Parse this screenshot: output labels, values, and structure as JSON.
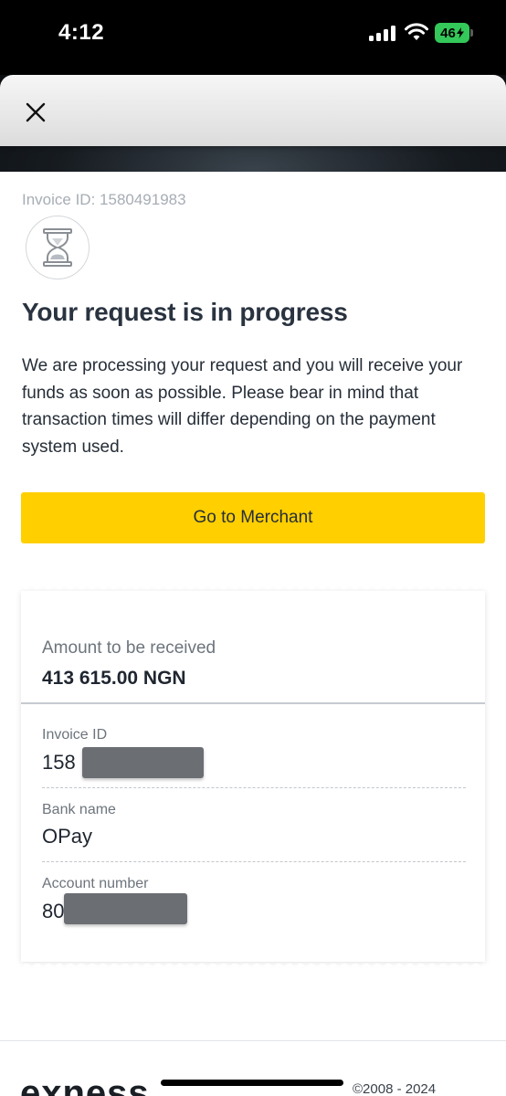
{
  "status_bar": {
    "time": "4:12",
    "battery": "46"
  },
  "header": {
    "close_icon": "close-icon"
  },
  "content": {
    "invoice_line": "Invoice ID: 1580491983",
    "status_icon": "hourglass-icon",
    "title": "Your request is in progress",
    "description": "We are processing your request and you will receive your funds as soon as possible. Please bear in mind that transaction times will differ depending on the payment system used.",
    "merchant_button": "Go to Merchant"
  },
  "receipt": {
    "amount_label": "Amount to be received",
    "amount_value": "413 615.00 NGN",
    "fields": [
      {
        "label": "Invoice ID",
        "value": "158"
      },
      {
        "label": "Bank name",
        "value": "OPay"
      },
      {
        "label": "Account number",
        "value": "80"
      }
    ]
  },
  "footer": {
    "logo": "exness",
    "copyright": "©2008 - 2024"
  },
  "colors": {
    "accent": "#ffcf00",
    "text_primary": "#262e38",
    "text_muted": "#6d747c",
    "battery": "#34c759"
  }
}
